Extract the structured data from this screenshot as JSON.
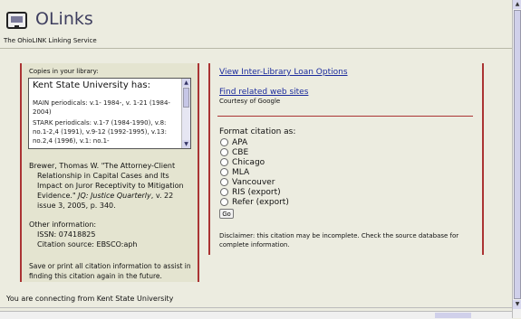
{
  "header": {
    "logo_text": "OLinks",
    "tagline": "The OhioLINK Linking Service"
  },
  "left": {
    "copies_label": "Copies in your library:",
    "library_name": "Kent State University has:",
    "holdings": [
      "MAIN periodicals: v.1- 1984-, v. 1-21 (1984-2004)",
      "STARK periodicals: v.1-7 (1984-1990), v.8: no.1-2,4 (1991), v.9-12 (1992-1995), v.13: no.2,4 (1996), v.1: no.1-"
    ],
    "citation": {
      "line1": "Brewer, Thomas W. \"The Attorney-Client",
      "line2": "Relationship in Capital Cases and Its",
      "line3": "Impact on Juror Receptivity to Mitigation",
      "line4_plain": "Evidence.\" ",
      "line4_italic": "JQ: Justice Quarterly",
      "line4_end": ", v. 22",
      "line5": "issue 3, 2005, p. 340."
    },
    "other_info_label": "Other information:",
    "issn": "ISSN: 07418825",
    "citation_source": "Citation source: EBSCO:aph",
    "save_note": "Save or print all citation information to assist in finding this citation again in the future."
  },
  "right": {
    "ill_link": "View Inter-Library Loan Options",
    "related_link": "Find related web sites",
    "courtesy": "Courtesy of Google",
    "format_title": "Format citation as:",
    "formats": [
      "APA",
      "CBE",
      "Chicago",
      "MLA",
      "Vancouver",
      "RIS (export)",
      "Refer (export)"
    ],
    "go_label": "Go",
    "disclaimer": "Disclaimer: this citation may be incomplete. Check the source database for complete information."
  },
  "footer": {
    "connecting": "You are connecting from Kent State University"
  },
  "colors": {
    "panel_border": "#aa3333",
    "link": "#1a2a9c",
    "background": "#ecece0"
  }
}
